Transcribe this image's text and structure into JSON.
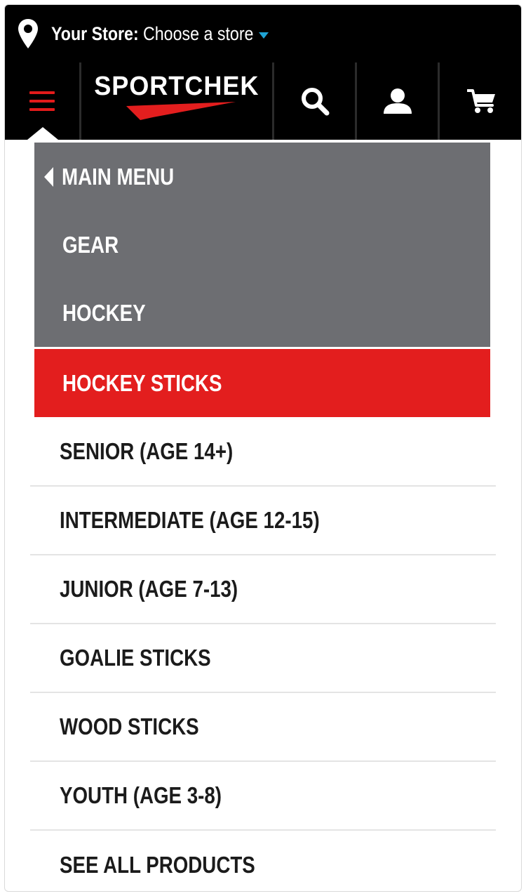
{
  "header": {
    "store_label": "Your Store:",
    "store_value": "Choose a store",
    "logo_text": "SPORTCHEK",
    "icons": [
      "location-pin-icon",
      "menu-icon",
      "search-icon",
      "user-icon",
      "cart-icon"
    ]
  },
  "menu": {
    "back_label": "MAIN MENU",
    "breadcrumbs": [
      "GEAR",
      "HOCKEY"
    ],
    "active": "HOCKEY STICKS"
  },
  "list": {
    "items": [
      "SENIOR (AGE 14+)",
      "INTERMEDIATE (AGE 12-15)",
      "JUNIOR (AGE 7-13)",
      "GOALIE STICKS",
      "WOOD STICKS",
      "YOUTH (AGE 3-8)",
      "SEE ALL PRODUCTS"
    ]
  },
  "colors": {
    "header_bg": "#000000",
    "accent_red": "#e31e1e",
    "menu_gray": "#6d6e72",
    "caret_blue": "#1fa3d4"
  }
}
